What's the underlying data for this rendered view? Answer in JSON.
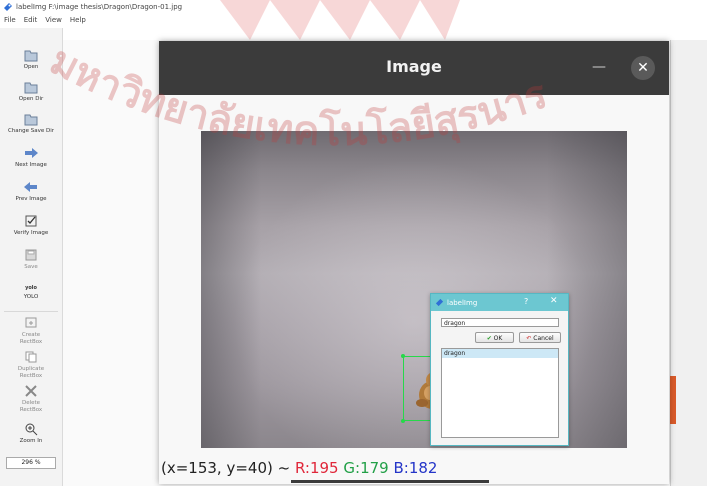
{
  "window": {
    "title": "labelImg F:\\image thesis\\Dragon\\Dragon-01.jpg",
    "menu": [
      "File",
      "Edit",
      "View",
      "Help"
    ]
  },
  "toolbar": {
    "items": [
      {
        "label": "Open",
        "icon": "folder-open-icon"
      },
      {
        "label": "Open Dir",
        "icon": "folder-open-icon"
      },
      {
        "label": "Change Save Dir",
        "icon": "folder-open-icon"
      },
      {
        "label": "Next Image",
        "icon": "arrow-right-icon"
      },
      {
        "label": "Prev Image",
        "icon": "arrow-left-icon"
      },
      {
        "label": "Verify Image",
        "icon": "checkbox-icon"
      },
      {
        "label": "Save",
        "icon": "save-icon"
      },
      {
        "label": "YOLO",
        "icon": "yolo-format-icon",
        "badge": "yolo"
      },
      {
        "label": "Create\nRectBox",
        "icon": "create-rectbox-icon"
      },
      {
        "label": "Duplicate\nRectBox",
        "icon": "duplicate-icon"
      },
      {
        "label": "Delete\nRectBox",
        "icon": "delete-icon"
      },
      {
        "label": "Zoom In",
        "icon": "zoom-in-icon"
      }
    ],
    "zoom_value": "296 %"
  },
  "image_window": {
    "title": "Image",
    "minimize": "—",
    "close": "✕",
    "coords": {
      "position": "(x=153, y=40) ~ ",
      "r": "R:195",
      "g": "G:179",
      "b": "B:182"
    }
  },
  "dialog": {
    "title": "labelImg",
    "help": "?",
    "close": "✕",
    "input_value": "dragon",
    "ok_label": "OK",
    "cancel_label": "Cancel",
    "list_items": [
      "dragon"
    ]
  },
  "colors": {
    "bbox": "#27d84a",
    "dialog_title_bar": "#6cc7d1",
    "image_header": "#3b3b3b",
    "watermark": "#d94a4a"
  },
  "watermark_text": "มหาวิทยาลัยเทคโนโลยีสุรนาร"
}
